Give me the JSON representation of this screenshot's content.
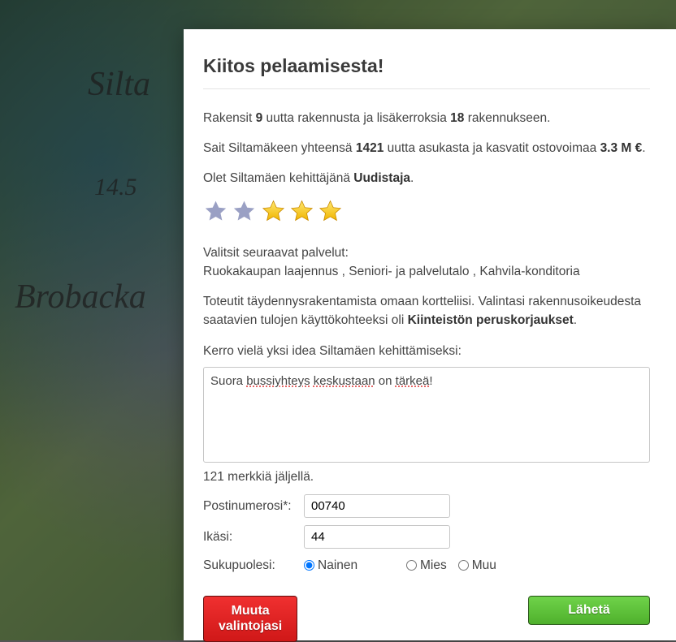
{
  "map_labels": {
    "silta": "Silta",
    "num": "14.5",
    "brobacka": "Brobacka"
  },
  "modal": {
    "title": "Kiitos pelaamisesta!",
    "line1": {
      "pre": "Rakensit ",
      "new_buildings": "9",
      "mid": " uutta rakennusta ja lisäkerroksia ",
      "ext_buildings": "18",
      "post": " rakennukseen."
    },
    "line2": {
      "pre": "Sait Siltamäkeen yhteensä ",
      "residents": "1421",
      "mid": " uutta asukasta ja kasvatit ostovoimaa ",
      "power": "3.3 M €",
      "post": "."
    },
    "line3": {
      "pre": "Olet Siltamäen kehittäjänä ",
      "role": "Uudistaja",
      "post": "."
    },
    "stars_filled": 2,
    "stars_gold": 3,
    "services_lead": "Valitsit seuraavat palvelut:",
    "services_list": "Ruokakaupan laajennus , Seniori- ja palvelutalo , Kahvila-konditoria",
    "line4": {
      "pre": "Toteutit täydennysrakentamista omaan kortteliisi. Valintasi rakennusoikeudesta saatavien tulojen käyttökohteeksi oli ",
      "target": "Kiinteistön peruskorjaukset",
      "post": "."
    },
    "idea_label": "Kerro vielä yksi idea Siltamäen kehittämiseksi:",
    "idea_value_pre": "Suora ",
    "idea_value_w1": "bussiyhteys",
    "idea_value_mid1": " ",
    "idea_value_w2": "keskustaan",
    "idea_value_mid2": " on ",
    "idea_value_w3": "tärkeä",
    "idea_value_post": "!",
    "chars_left": "121 merkkiä jäljellä.",
    "postal_label": "Postinumerosi*:",
    "postal_value": "00740",
    "age_label": "Ikäsi:",
    "age_value": "44",
    "gender_label": "Sukupuolesi:",
    "gender_options": {
      "f": "Nainen",
      "m": "Mies",
      "o": "Muu"
    },
    "gender_selected": "f",
    "btn_change_l1": "Muuta",
    "btn_change_l2": "valintojasi",
    "btn_send": "Lähetä"
  }
}
